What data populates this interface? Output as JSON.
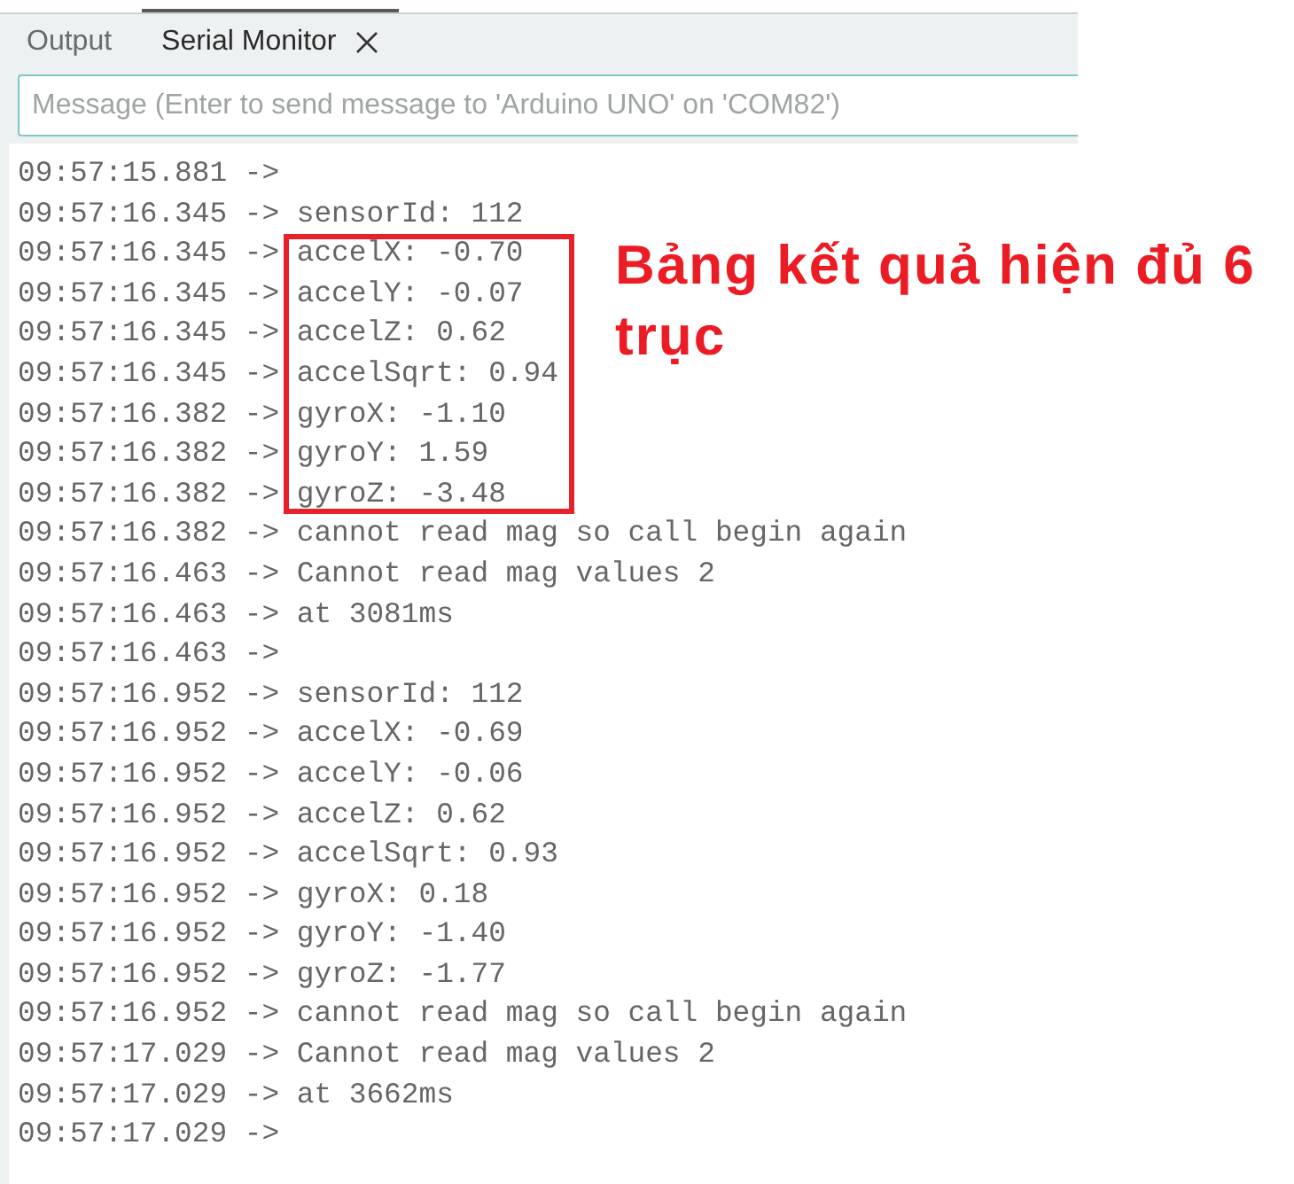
{
  "tabs": [
    {
      "label": "Output",
      "selected": false,
      "closable": false
    },
    {
      "label": "Serial Monitor",
      "selected": true,
      "closable": true
    }
  ],
  "message_field": {
    "placeholder": "Message (Enter to send message to 'Arduino UNO' on 'COM82')"
  },
  "log_blocks": [
    {
      "highlighted": false,
      "lines": [
        "09:57:15.881 ->",
        "09:57:16.345 -> sensorId: 112"
      ]
    },
    {
      "highlighted": true,
      "lines": [
        "09:57:16.345 -> accelX: -0.70",
        "09:57:16.345 -> accelY: -0.07",
        "09:57:16.345 -> accelZ: 0.62",
        "09:57:16.345 -> accelSqrt: 0.94",
        "09:57:16.382 -> gyroX: -1.10",
        "09:57:16.382 -> gyroY: 1.59",
        "09:57:16.382 -> gyroZ: -3.48"
      ]
    },
    {
      "highlighted": false,
      "lines": [
        "09:57:16.382 -> cannot read mag so call begin again",
        "09:57:16.463 -> Cannot read mag values 2",
        "09:57:16.463 -> at 3081ms",
        "09:57:16.463 ->",
        "09:57:16.952 -> sensorId: 112",
        "09:57:16.952 -> accelX: -0.69",
        "09:57:16.952 -> accelY: -0.06",
        "09:57:16.952 -> accelZ: 0.62",
        "09:57:16.952 -> accelSqrt: 0.93",
        "09:57:16.952 -> gyroX: 0.18",
        "09:57:16.952 -> gyroY: -1.40",
        "09:57:16.952 -> gyroZ: -1.77",
        "09:57:16.952 -> cannot read mag so call begin again",
        "09:57:17.029 -> Cannot read mag values 2",
        "09:57:17.029 -> at 3662ms",
        "09:57:17.029 ->"
      ]
    }
  ],
  "annotation": {
    "text": "Bảng kết quả hiện đủ 6 trục"
  }
}
